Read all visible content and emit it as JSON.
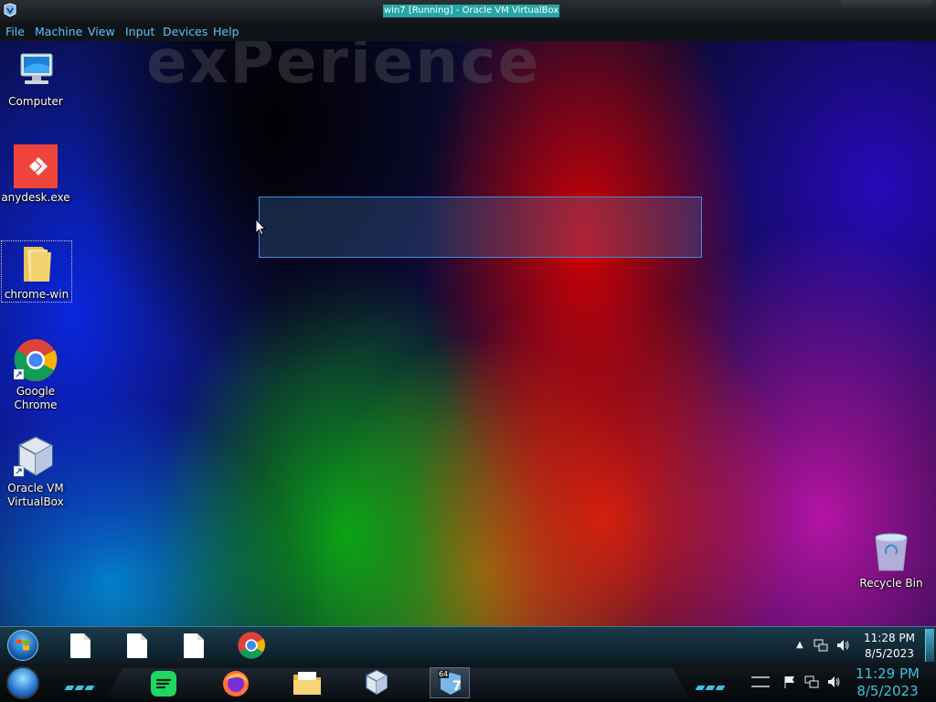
{
  "window": {
    "title": "win7 [Running] - Oracle VM VirtualBox"
  },
  "menubar": {
    "items": [
      "File",
      "Machine",
      "View",
      "Input",
      "Devices",
      "Help"
    ]
  },
  "desktop": {
    "watermark": "exPerience",
    "icons": [
      {
        "label": "Computer",
        "icon": "computer-icon"
      },
      {
        "label": "anydesk.exe",
        "icon": "anydesk-icon"
      },
      {
        "label": "chrome-win",
        "icon": "folder-icon"
      },
      {
        "label": "Google Chrome",
        "icon": "chrome-icon"
      },
      {
        "label": "Oracle VM VirtualBox",
        "icon": "virtualbox-icon"
      },
      {
        "label": "Recycle Bin",
        "icon": "recycle-bin-icon"
      }
    ]
  },
  "taskbar": {
    "pinned": [
      "document-icon",
      "document-icon",
      "document-icon",
      "chrome-icon"
    ],
    "tray": {
      "time": "11:28 PM",
      "date": "8/5/2023"
    }
  },
  "host_taskbar": {
    "apps": [
      "spotify-icon",
      "firefox-icon",
      "file-explorer-icon",
      "virtualbox-icon",
      "windows7-vm-icon"
    ],
    "vm_badge": "64",
    "vm_number": "7",
    "clock": {
      "time": "11:29 PM",
      "date": "8/5/2023"
    }
  },
  "colors": {
    "menu_text": "#5ec2ff",
    "accent_cyan": "#35c6e0",
    "title_highlight": "#27a6a6"
  }
}
